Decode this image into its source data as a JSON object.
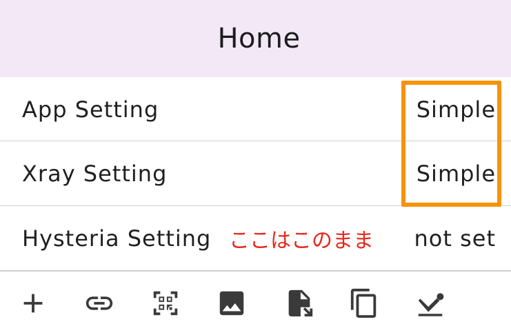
{
  "appbar": {
    "title": "Home"
  },
  "settings": [
    {
      "label": "App Setting",
      "value": "Simple"
    },
    {
      "label": "Xray Setting",
      "value": "Simple"
    },
    {
      "label": "Hysteria Setting",
      "value": "not set",
      "note": "ここはこのまま"
    }
  ],
  "annotation": {
    "highlight_color": "#f6930a",
    "note_color": "#e8271b"
  },
  "toolbar": {
    "icons": [
      "add-icon",
      "link-icon",
      "qr-code-scanner-icon",
      "image-icon",
      "file-import-icon",
      "copy-icon",
      "chart-download-icon"
    ]
  },
  "colors": {
    "appbar_bg": "#f3e9f6",
    "divider": "#cfcfcf",
    "icon": "#3a3a3a"
  }
}
